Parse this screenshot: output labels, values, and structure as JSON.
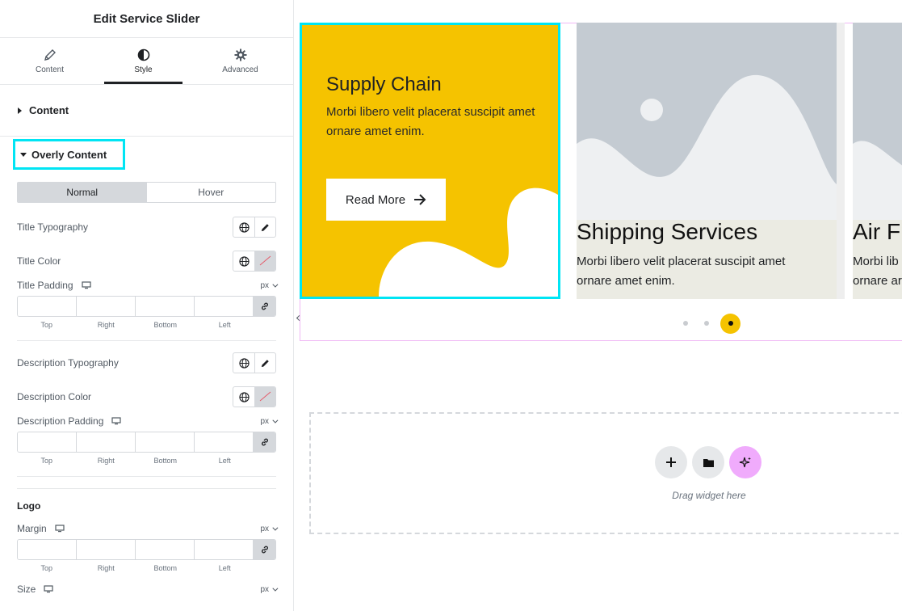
{
  "panel": {
    "title": "Edit Service Slider",
    "tabs": [
      {
        "label": "Content",
        "icon": "pencil-icon"
      },
      {
        "label": "Style",
        "icon": "contrast-icon"
      },
      {
        "label": "Advanced",
        "icon": "gear-icon"
      }
    ],
    "section_content": "Content",
    "section_overly": "Overly Content",
    "state_tabs": [
      "Normal",
      "Hover"
    ],
    "title_typography": "Title Typography",
    "title_color": "Title Color",
    "title_padding": "Title Padding",
    "description_typography": "Description Typography",
    "description_color": "Description Color",
    "description_padding": "Description Padding",
    "logo_heading": "Logo",
    "margin": "Margin",
    "size": "Size",
    "unit": "px",
    "dim_labels": [
      "Top",
      "Right",
      "Bottom",
      "Left"
    ]
  },
  "canvas": {
    "slides": [
      {
        "title": "Supply Chain",
        "description": "Morbi libero velit placerat suscipit amet ornare amet enim.",
        "button": "Read More"
      },
      {
        "title": "Shipping Services",
        "description": "Morbi libero velit placerat suscipit amet ornare amet enim."
      },
      {
        "title": "Air Fr",
        "description": "Morbi lib ornare ar"
      }
    ],
    "dropzone_text": "Drag widget here",
    "accent": "#f5c300",
    "selection": "#00e5f4"
  }
}
